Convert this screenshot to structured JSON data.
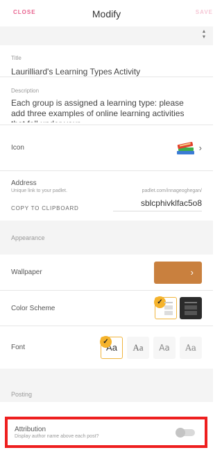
{
  "header": {
    "close_label": "CLOSE",
    "title": "Modify",
    "save_label": "SAVE"
  },
  "title_field": {
    "label": "Title",
    "value": "Laurilliard's Learning Types Activity"
  },
  "description_field": {
    "label": "Description",
    "value": "Each group is assigned a learning type: please add three examples of online learning activities that fall under your"
  },
  "icon_field": {
    "label": "Icon",
    "icon": "books-icon"
  },
  "address_field": {
    "label": "Address",
    "hint": "Unique link to your padlet.",
    "url_prefix": "padlet.com/innageoghegan/",
    "copy_label": "COPY TO CLIPBOARD",
    "slug": "sblcphivklfac5o8"
  },
  "appearance": {
    "section_label": "Appearance",
    "wallpaper_label": "Wallpaper",
    "color_scheme_label": "Color Scheme",
    "font_label": "Font",
    "font_sample": "Aa",
    "colors": {
      "wallpaper": "#c9803e",
      "selection": "#f5b32c",
      "accent": "#e8628e"
    }
  },
  "posting": {
    "section_label": "Posting",
    "attribution_label": "Attribution",
    "attribution_hint": "Display author name above each post?",
    "attribution_on": false
  }
}
